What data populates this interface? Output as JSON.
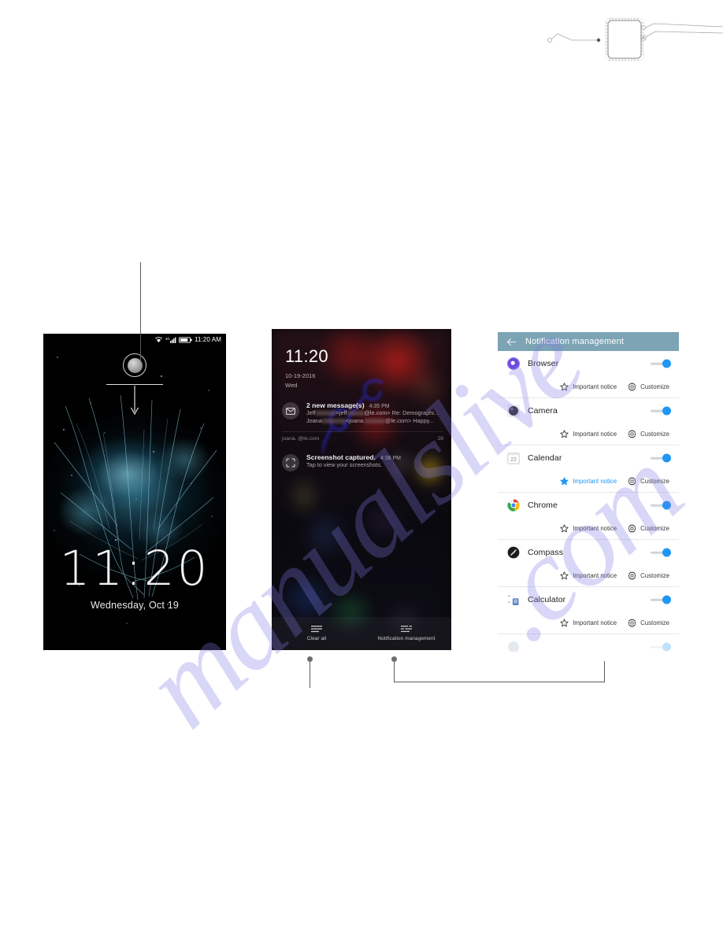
{
  "watermark": {
    "line1": "manualslive",
    "line2": ".com"
  },
  "diagram": {
    "name": "ic-chip-callout-diagram"
  },
  "lock_screen": {
    "status_bar": {
      "wifi_icon": "wifi-icon",
      "signal_icon": "cellular-signal-icon",
      "battery_icon": "battery-icon",
      "time": "11:20 AM"
    },
    "unlock_hint_icon": "unlock-ring-icon",
    "swipe_down_arrow_icon": "arrow-down-icon",
    "clock": "11:20",
    "date": "Wednesday, Oct 19"
  },
  "notification_shade": {
    "time": "11:20",
    "date": "10-19-2016",
    "weekday": "Wed",
    "notifications": [
      {
        "icon": "email-icon",
        "title": "2 new message(s)",
        "time": "4:35 PM",
        "line1_prefix": "Jeff",
        "line1_mid": "<jeff",
        "line1_suffix": "@le.com> Re: Demographi...",
        "line2_prefix": "Joana",
        "line2_mid": "<joana.",
        "line2_suffix": "@le.com> Happy...",
        "account": "joana.                 @le.com",
        "count": "28"
      },
      {
        "icon": "screenshot-icon",
        "title": "Screenshot captured.",
        "time": "4:38 PM",
        "body": "Tap to view your screenshots."
      }
    ],
    "actions": [
      {
        "icon": "clear-all-icon",
        "label": "Clear all"
      },
      {
        "icon": "notification-management-icon",
        "label": "Notification management"
      }
    ]
  },
  "notification_management": {
    "back_icon": "back-arrow-icon",
    "title": "Notification management",
    "sub_labels": {
      "important": "Important notice",
      "customize": "Customize"
    },
    "sub_icons": {
      "important": "star-icon",
      "customize": "gear-icon"
    },
    "accent_color": "#2196f3",
    "header_color": "#7ca4b5",
    "apps": [
      {
        "name": "Browser",
        "icon": "browser-icon",
        "toggle": "on",
        "important_active": false
      },
      {
        "name": "Camera",
        "icon": "camera-icon",
        "toggle": "on",
        "important_active": false
      },
      {
        "name": "Calendar",
        "icon": "calendar-icon",
        "toggle": "on",
        "important_active": true
      },
      {
        "name": "Chrome",
        "icon": "chrome-icon",
        "toggle": "on",
        "important_active": false
      },
      {
        "name": "Compass",
        "icon": "compass-icon",
        "toggle": "on",
        "important_active": false
      },
      {
        "name": "Calculator",
        "icon": "calculator-icon",
        "toggle": "on",
        "important_active": false
      }
    ]
  }
}
